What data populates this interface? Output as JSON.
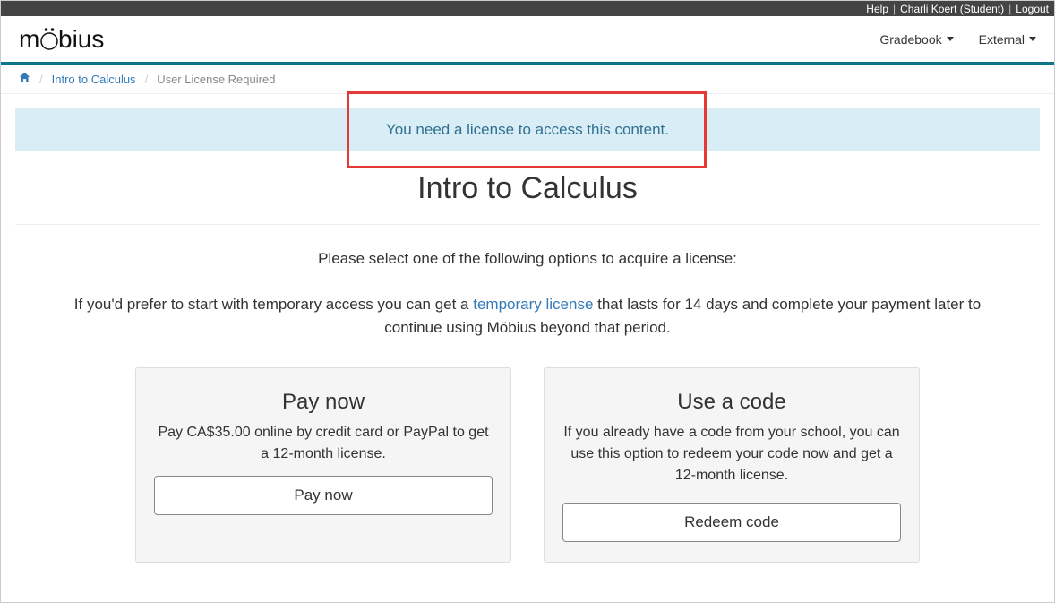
{
  "topbar": {
    "help": "Help",
    "user": "Charli Koert (Student)",
    "logout": "Logout"
  },
  "nav": {
    "gradebook": "Gradebook",
    "external": "External"
  },
  "breadcrumb": {
    "course": "Intro to Calculus",
    "current": "User License Required"
  },
  "alert": {
    "message": "You need a license to access this content."
  },
  "page_title": "Intro to Calculus",
  "instructions": "Please select one of the following options to acquire a license:",
  "temp_access": {
    "before": "If you'd prefer to start with temporary access you can get a ",
    "link": "temporary license",
    "after": " that lasts for 14 days and complete your payment later to continue using Möbius beyond that period."
  },
  "cards": {
    "pay": {
      "title": "Pay now",
      "desc": "Pay CA$35.00 online by credit card or PayPal to get a 12-month license.",
      "button": "Pay now"
    },
    "code": {
      "title": "Use a code",
      "desc": "If you already have a code from your school, you can use this option to redeem your code now and get a 12-month license.",
      "button": "Redeem code"
    }
  }
}
